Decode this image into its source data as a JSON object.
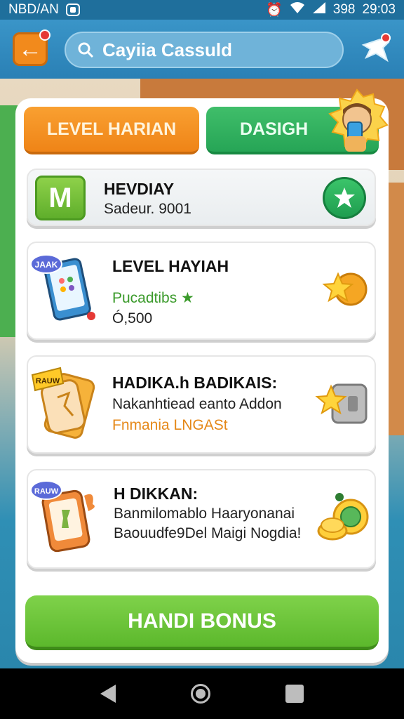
{
  "status_bar": {
    "carrier": "NBD/AN",
    "battery": "398",
    "time": "29:03"
  },
  "header": {
    "search_text": "Cayiia Cassuld"
  },
  "tabs": [
    {
      "label": "LEVEL HARIAN"
    },
    {
      "label": "DASIGH"
    }
  ],
  "daily": {
    "badge": "M",
    "title": "HEVDIAY",
    "subtitle": "Sadeur. 9001"
  },
  "cards": [
    {
      "title": "LEVEL HAYIAH",
      "line1": "Pucadtibs ★",
      "line2": "Ó,500",
      "illus_tag": "JAAK"
    },
    {
      "title": "HADIKA.h BADIKAIS:",
      "line1": "Nakanhtiead eanto Addon",
      "line2": "Fnmania LNGASt",
      "illus_tag": "RAUW"
    },
    {
      "title": "H DIKKAN:",
      "line1": "Banmilomablo Haaryonanai",
      "line2": "Baouudfe9Del Maigi Nogdia!",
      "illus_tag": "RAUW"
    }
  ],
  "bonus_button": {
    "label": "HANDI BONUS"
  },
  "colors": {
    "orange": "#f28a1c",
    "green": "#26a556",
    "bonus_green": "#5cb82c",
    "header_blue": "#2a80b5"
  }
}
